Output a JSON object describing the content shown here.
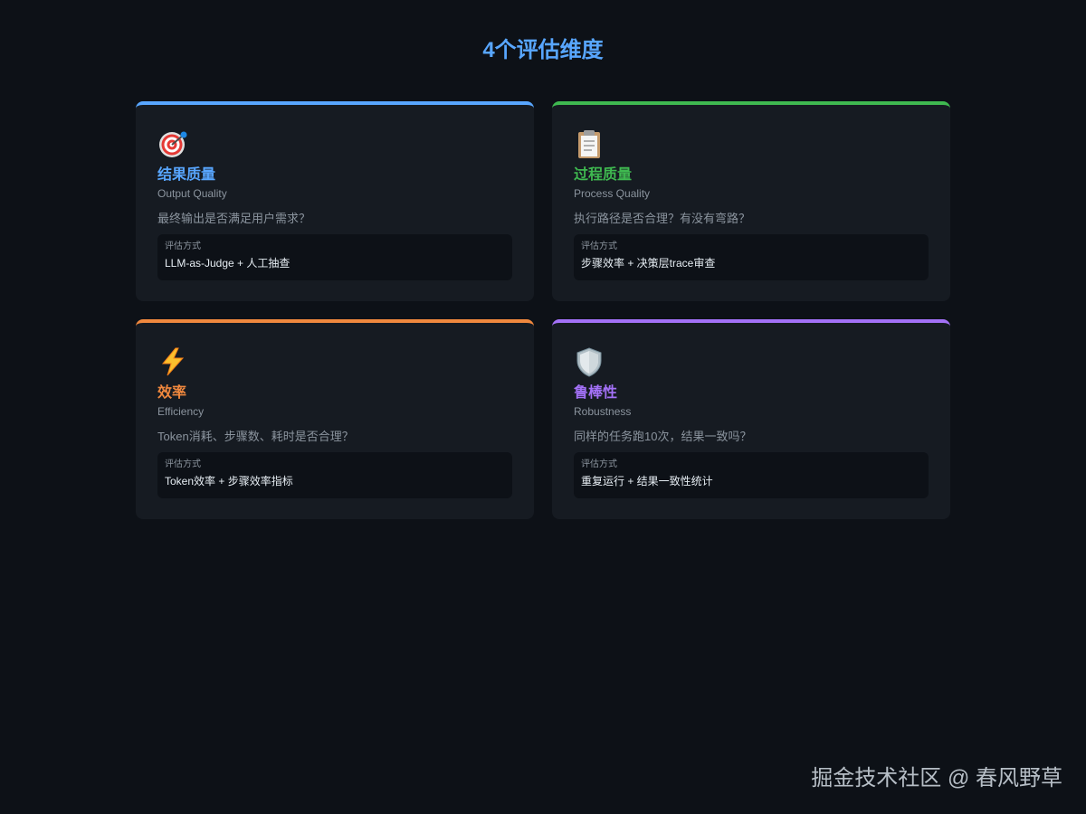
{
  "title": "4个评估维度",
  "colors": {
    "background": "#0d1117",
    "card": "#161b22",
    "blue": "#58a6ff",
    "green": "#3fb950",
    "orange": "#f0883e",
    "purple": "#a371f7"
  },
  "cards": [
    {
      "icon": "target-icon",
      "color": "#58a6ff",
      "title": "结果质量",
      "subtitle": "Output Quality",
      "question": "最终输出是否满足用户需求？",
      "method_label": "评估方式",
      "method_value": "LLM-as-Judge + 人工抽查"
    },
    {
      "icon": "clipboard-icon",
      "color": "#3fb950",
      "title": "过程质量",
      "subtitle": "Process Quality",
      "question": "执行路径是否合理？有没有弯路？",
      "method_label": "评估方式",
      "method_value": "步骤效率 + 决策层trace审查"
    },
    {
      "icon": "lightning-icon",
      "color": "#f0883e",
      "title": "效率",
      "subtitle": "Efficiency",
      "question": "Token消耗、步骤数、耗时是否合理？",
      "method_label": "评估方式",
      "method_value": "Token效率 + 步骤效率指标"
    },
    {
      "icon": "shield-icon",
      "color": "#a371f7",
      "title": "鲁棒性",
      "subtitle": "Robustness",
      "question": "同样的任务跑10次，结果一致吗？",
      "method_label": "评估方式",
      "method_value": "重复运行 + 结果一致性统计"
    }
  ],
  "watermark": "掘金技术社区 @ 春风野草"
}
